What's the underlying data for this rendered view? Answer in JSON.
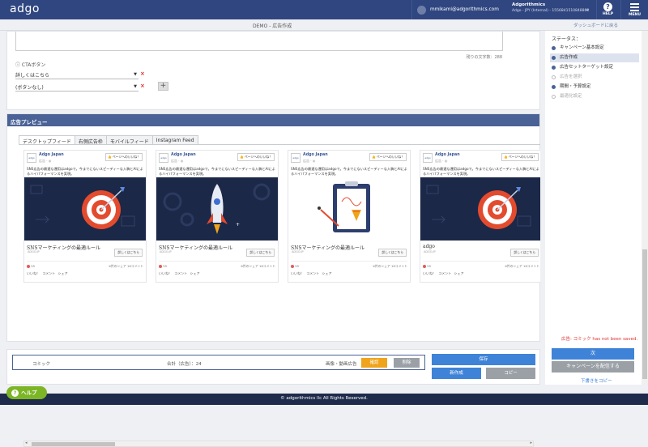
{
  "header": {
    "logo": "adgo",
    "user_email": "mmikami@adgorithmics.com",
    "org_name": "Adgorithmics",
    "org_sub": "Adgo - JPY (Internal) - 1556841510848860",
    "help_label": "HELP",
    "menu_label": "MENU"
  },
  "subbar": {
    "breadcrumb": "DEMO - 広告作成",
    "back_link": "ダッシュボードに戻る"
  },
  "form": {
    "char_count": "残りの文字数：288",
    "cta_label": "CTAボタン",
    "cta_select_1": "詳しくはこちら",
    "cta_select_2": "(ボタンなし)"
  },
  "preview": {
    "header": "広告プレビュー",
    "tabs": [
      "デスクトップフィード",
      "右側広告枠",
      "モバイルフィード",
      "Instagram Feed"
    ],
    "ads": [
      {
        "page_name": "Adgo Japan",
        "sponsored": "広告 · ",
        "like_btn": "ページへのいいね！",
        "text": "SNS広告の最適な運用はadgoで。今までにないスピーディーな入稿とAIによるハイパフォーマンスを実現。",
        "headline": "SNSマーケティングの最適ルール",
        "url": "ADGO.JP",
        "cta": "詳しくはこちら",
        "reactions": "55",
        "counts": "6件のシェア  16コメント",
        "actions": "いいね！ コメント シェア",
        "image": "target"
      },
      {
        "page_name": "Adgo Japan",
        "sponsored": "広告 · ",
        "like_btn": "ページへのいいね！",
        "text": "SNS広告の最適な運用はadgoで。今までにないスピーディーな入稿とAIによるハイパフォーマンスを実現。",
        "headline": "SNSマーケティングの最適ルール",
        "url": "ADGO.JP",
        "cta": "詳しくはこちら",
        "reactions": "55",
        "counts": "6件のシェア  16コメント",
        "actions": "いいね！ コメント シェア",
        "image": "rocket"
      },
      {
        "page_name": "Adgo Japan",
        "sponsored": "広告 · ",
        "like_btn": "ページへのいいね！",
        "text": "SNS広告の最適な運用はadgoで。今までにないスピーディーな入稿とAIによるハイパフォーマンスを実現。",
        "headline": "SNSマーケティングの最適ルール",
        "url": "ADGO.JP",
        "cta": "詳しくはこちら",
        "reactions": "55",
        "counts": "6件のシェア  16コメント",
        "actions": "いいね！ コメント シェア",
        "image": "clipboard"
      },
      {
        "page_name": "Adgo Japan",
        "sponsored": "広告 · ",
        "like_btn": "ページへのいいね！",
        "text": "SNS広告の最適な運用はadgoで。今までにないスピーディーな入稿とAIによるハイパフォーマンスを実現。",
        "headline": "adgo",
        "url": "ADGO.JP",
        "cta": "詳しくはこちら",
        "reactions": "55",
        "counts": "6件のシェア  16コメント",
        "actions": "いいね！ コメント シェア",
        "image": "target"
      }
    ]
  },
  "footer": {
    "name": "コミック",
    "total": "合計（広告）：24",
    "type": "画像・動画広告",
    "confirm_btn": "確認",
    "delete_btn": "削除",
    "save_btn": "保存",
    "new_btn": "新作成",
    "copy_btn": "コピー"
  },
  "sidebar": {
    "title": "ステータス：",
    "steps": [
      {
        "label": "キャンペーン基本設定",
        "state": "filled"
      },
      {
        "label": "広告作成",
        "state": "filled"
      },
      {
        "label": "広告セットターゲット設定",
        "state": "filled"
      },
      {
        "label": "広告を選択",
        "state": "empty"
      },
      {
        "label": "期間・予算設定",
        "state": "filled"
      },
      {
        "label": "最適化設定",
        "state": "empty"
      }
    ],
    "error": "広告: コミック has not been saved.",
    "next_btn": "次",
    "deploy_btn": "キャンペーンを配信する",
    "copy_link": "下書きをコピー"
  },
  "bottom": {
    "copyright": "© adgorithmics llc All Rights Reserved.",
    "help_btn": "ヘルプ"
  },
  "colors": {
    "nav": "#2f4680",
    "accent": "#4a6296",
    "primary": "#3f83d8",
    "warning": "#f0a41b",
    "help": "#7cb526"
  }
}
